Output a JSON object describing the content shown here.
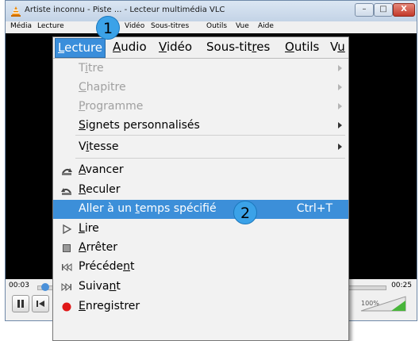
{
  "window": {
    "title": "Artiste inconnu - Piste ... - Lecteur multimédia VLC",
    "minimize": "–",
    "maximize": "□",
    "close": "X"
  },
  "menubar": [
    "Média",
    "Lecture",
    "Audio",
    "Vidéo",
    "Sous-titres",
    "Outils",
    "Vue",
    "Aide"
  ],
  "zoomed_menubar": [
    {
      "label": "Lecture",
      "u": 0
    },
    {
      "label": "Audio",
      "u": 0
    },
    {
      "label": "Vidéo",
      "u": 0
    },
    {
      "label": "Sous-titres",
      "u": 8
    },
    {
      "label": "Outils",
      "u": 0
    },
    {
      "label": "Vu",
      "u": 1
    }
  ],
  "menu_items": [
    {
      "label": "Titre",
      "u": 1,
      "disabled": true,
      "submenu": true
    },
    {
      "label": "Chapitre",
      "u": 0,
      "disabled": true,
      "submenu": true
    },
    {
      "label": "Programme",
      "u": 0,
      "disabled": true,
      "submenu": true
    },
    {
      "label": "Signets personnalisés",
      "u": 0,
      "disabled": false,
      "submenu": true
    },
    {
      "label": "Vitesse",
      "u": 1,
      "disabled": false,
      "submenu": true
    },
    {
      "label": "Avancer",
      "u": 0,
      "icon": "forward-icon"
    },
    {
      "label": "Reculer",
      "u": 0,
      "icon": "backward-icon"
    },
    {
      "label": "Aller à un temps spécifié",
      "u": 11,
      "shortcut": "Ctrl+T",
      "highlighted": true
    },
    {
      "label": "Lire",
      "u": 0,
      "icon": "play-icon"
    },
    {
      "label": "Arrêter",
      "u": 0,
      "icon": "stop-icon"
    },
    {
      "label": "Précédent",
      "u": 7,
      "icon": "previous-icon"
    },
    {
      "label": "Suivant",
      "u": 5,
      "icon": "next-icon"
    },
    {
      "label": "Enregistrer",
      "u": 0,
      "icon": "record-icon"
    }
  ],
  "controls": {
    "time_elapsed": "00:03",
    "time_total": "00:25",
    "volume": "100%"
  },
  "badges": [
    "1",
    "2"
  ],
  "colors": {
    "highlight": "#3c8fd9",
    "badge": "#3ba2e8",
    "record": "#e01818"
  }
}
